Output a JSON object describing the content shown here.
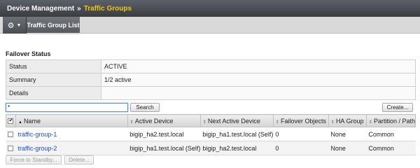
{
  "breadcrumb": {
    "root": "Device Management",
    "separator": "»",
    "current": "Traffic Groups"
  },
  "tabs": {
    "gear_icon": "gear-icon",
    "active_tab": "Traffic Group List"
  },
  "failover": {
    "title": "Failover Status",
    "rows": [
      {
        "key": "Status",
        "value": "ACTIVE"
      },
      {
        "key": "Summary",
        "value": "1/2 active"
      },
      {
        "key": "Details",
        "value": ""
      }
    ]
  },
  "search": {
    "value": "*",
    "button_label": "Search",
    "create_label": "Create..."
  },
  "table": {
    "columns": [
      "Name",
      "Active Device",
      "Next Active Device",
      "Failover Objects",
      "HA Group",
      "Partition / Path"
    ],
    "rows": [
      {
        "name": "traffic-group-1",
        "active": "bigip_ha2.test.local",
        "next": "bigip_ha1.test.local (Self)",
        "objects": "0",
        "ha_group": "None",
        "partition": "Common"
      },
      {
        "name": "traffic-group-2",
        "active": "bigip_ha1.test.local (Self)",
        "next": "bigip_ha2.test.local",
        "objects": "0",
        "ha_group": "None",
        "partition": "Common"
      }
    ]
  },
  "footer": {
    "force_label": "Force to Standby...",
    "delete_label": "Delete..."
  },
  "colors": {
    "accent": "#f2c12e",
    "link": "#1f4fb5",
    "header_bg": "#3a3d42"
  }
}
